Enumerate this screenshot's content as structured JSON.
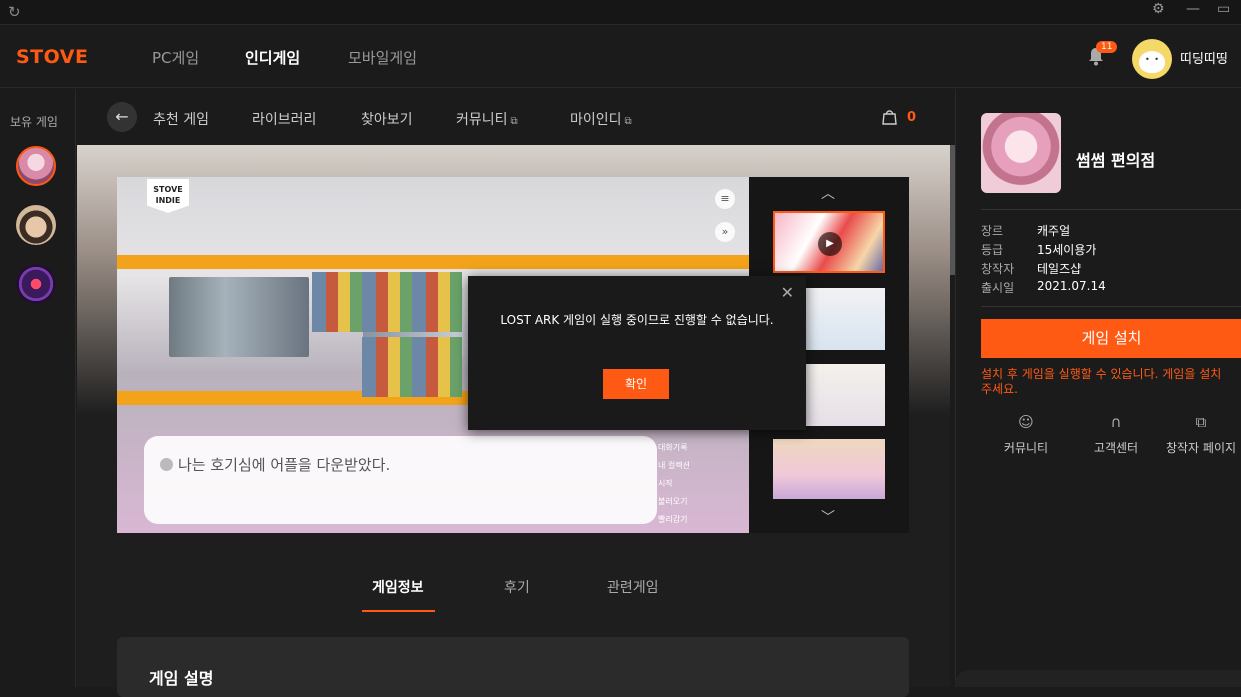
{
  "window": {
    "refresh_icon": "refresh-icon",
    "settings_icon": "gear-icon",
    "minimize_icon": "minimize-icon",
    "maximize_icon": "maximize-icon"
  },
  "topnav": {
    "logo": "STOVE",
    "items": [
      "PC게임",
      "인디게임",
      "모바일게임"
    ],
    "active_index": 1,
    "notification_count": "11",
    "username": "띠딩띠띵"
  },
  "sidebar": {
    "title": "보유 게임"
  },
  "subnav": {
    "items": [
      "추천 게임",
      "라이브러리",
      "찾아보기",
      "커뮤니티",
      "마이인디"
    ],
    "external_icon": "⧉",
    "cart_count": "0"
  },
  "media": {
    "brand_badge": [
      "STOVE",
      "INDIE"
    ],
    "dialogue": "나는 호기심에 어플을 다운받았다.",
    "menu_items": [
      "대화기록",
      "내 컬렉션",
      "시작",
      "불러오기",
      "빨리감기"
    ],
    "up_arrow": "︿",
    "down_arrow": "﹀"
  },
  "modal": {
    "message": "LOST ARK 게임이 실행 중이므로 진행할 수 없습니다.",
    "confirm_label": "확인",
    "close": "✕"
  },
  "tabs": [
    "게임정보",
    "후기",
    "관련게임"
  ],
  "description": {
    "heading": "게임 설명"
  },
  "game": {
    "title": "썸썸 편의점",
    "info": [
      {
        "label": "장르",
        "value": "캐주얼"
      },
      {
        "label": "등급",
        "value": "15세이용가"
      },
      {
        "label": "창작자",
        "value": "테일즈샵"
      },
      {
        "label": "출시일",
        "value": "2021.07.14"
      }
    ],
    "install_label": "게임 설치",
    "install_note": [
      "설치 후 게임을 실행할 수 있습니다. 게임을 설치",
      "주세요."
    ],
    "links": [
      "커뮤니티",
      "고객센터",
      "창작자 페이지"
    ]
  },
  "colors": {
    "accent": "#ff5a14",
    "background": "#1b1b1b"
  }
}
